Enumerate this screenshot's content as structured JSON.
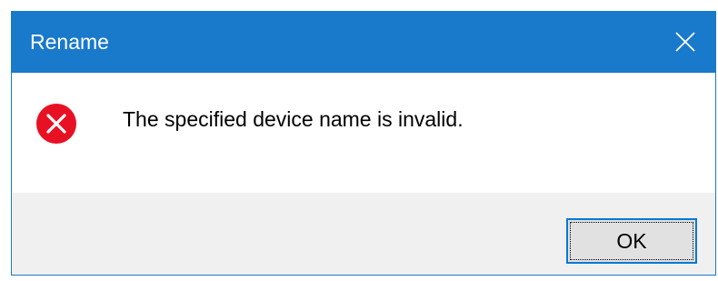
{
  "window": {
    "title": "Rename",
    "close_icon": "close-icon",
    "titlebar_color": "#1979ca"
  },
  "content": {
    "icon": "error-icon",
    "icon_color": "#e81123",
    "message": "The specified device name is invalid."
  },
  "buttons": {
    "ok_label": "OK"
  }
}
